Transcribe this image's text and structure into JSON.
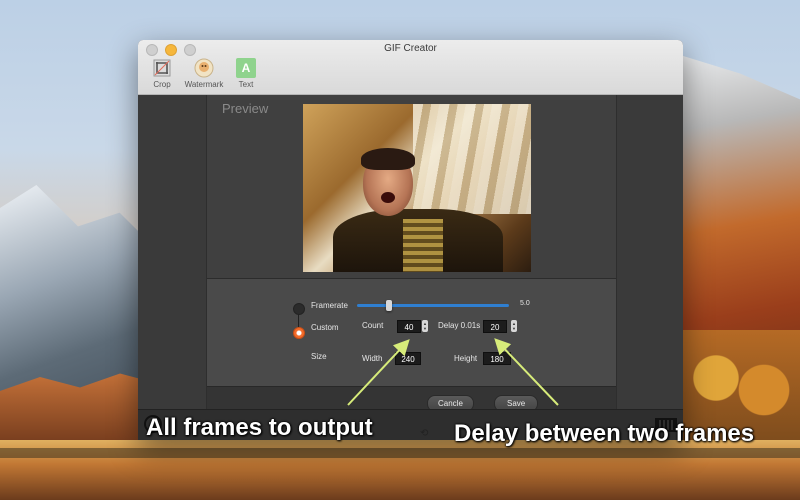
{
  "window": {
    "title": "GIF Creator"
  },
  "toolbar": {
    "items": [
      {
        "label": "Crop",
        "icon": "crop-icon"
      },
      {
        "label": "Watermark",
        "icon": "watermark-icon"
      },
      {
        "label": "Text",
        "icon": "text-icon",
        "glyph": "A"
      }
    ]
  },
  "preview": {
    "label": "Preview"
  },
  "settings": {
    "framerate": {
      "label": "Framerate",
      "value": "5.0",
      "slider_fraction": 0.2
    },
    "custom": {
      "label": "Custom",
      "selected": true
    },
    "count": {
      "label": "Count",
      "value": "40"
    },
    "delay": {
      "label": "Delay 0.01s",
      "value": "20"
    },
    "size": {
      "label": "Size"
    },
    "width": {
      "label": "Width",
      "value": "240"
    },
    "height": {
      "label": "Height",
      "value": "180"
    }
  },
  "buttons": {
    "cancel": "Cancle",
    "save": "Save"
  },
  "annotations": {
    "left": "All frames to output",
    "right": "Delay between two frames"
  },
  "colors": {
    "arrow": "#d7ec7a",
    "slider": "#2f7fd1",
    "radio_active": "#f26b2a"
  }
}
